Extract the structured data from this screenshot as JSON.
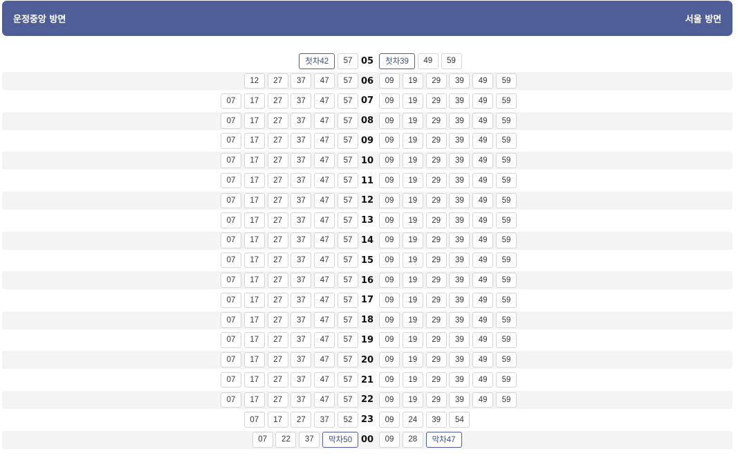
{
  "header": {
    "left_direction": "운정중앙 방면",
    "right_direction": "서울 방면"
  },
  "colors": {
    "accent": "#505e97",
    "row_alt": "#f4f4f4"
  },
  "schedule": [
    {
      "hour": "05",
      "left": [
        "첫차42",
        "57"
      ],
      "right": [
        "첫차39",
        "49",
        "59"
      ]
    },
    {
      "hour": "06",
      "left": [
        "12",
        "27",
        "37",
        "47",
        "57"
      ],
      "right": [
        "09",
        "19",
        "29",
        "39",
        "49",
        "59"
      ]
    },
    {
      "hour": "07",
      "left": [
        "07",
        "17",
        "27",
        "37",
        "47",
        "57"
      ],
      "right": [
        "09",
        "19",
        "29",
        "39",
        "49",
        "59"
      ]
    },
    {
      "hour": "08",
      "left": [
        "07",
        "17",
        "27",
        "37",
        "47",
        "57"
      ],
      "right": [
        "09",
        "19",
        "29",
        "39",
        "49",
        "59"
      ]
    },
    {
      "hour": "09",
      "left": [
        "07",
        "17",
        "27",
        "37",
        "47",
        "57"
      ],
      "right": [
        "09",
        "19",
        "29",
        "39",
        "49",
        "59"
      ]
    },
    {
      "hour": "10",
      "left": [
        "07",
        "17",
        "27",
        "37",
        "47",
        "57"
      ],
      "right": [
        "09",
        "19",
        "29",
        "39",
        "49",
        "59"
      ]
    },
    {
      "hour": "11",
      "left": [
        "07",
        "17",
        "27",
        "37",
        "47",
        "57"
      ],
      "right": [
        "09",
        "19",
        "29",
        "39",
        "49",
        "59"
      ]
    },
    {
      "hour": "12",
      "left": [
        "07",
        "17",
        "27",
        "37",
        "47",
        "57"
      ],
      "right": [
        "09",
        "19",
        "29",
        "39",
        "49",
        "59"
      ]
    },
    {
      "hour": "13",
      "left": [
        "07",
        "17",
        "27",
        "37",
        "47",
        "57"
      ],
      "right": [
        "09",
        "19",
        "29",
        "39",
        "49",
        "59"
      ]
    },
    {
      "hour": "14",
      "left": [
        "07",
        "17",
        "27",
        "37",
        "47",
        "57"
      ],
      "right": [
        "09",
        "19",
        "29",
        "39",
        "49",
        "59"
      ]
    },
    {
      "hour": "15",
      "left": [
        "07",
        "17",
        "27",
        "37",
        "47",
        "57"
      ],
      "right": [
        "09",
        "19",
        "29",
        "39",
        "49",
        "59"
      ]
    },
    {
      "hour": "16",
      "left": [
        "07",
        "17",
        "27",
        "37",
        "47",
        "57"
      ],
      "right": [
        "09",
        "19",
        "29",
        "39",
        "49",
        "59"
      ]
    },
    {
      "hour": "17",
      "left": [
        "07",
        "17",
        "27",
        "37",
        "47",
        "57"
      ],
      "right": [
        "09",
        "19",
        "29",
        "39",
        "49",
        "59"
      ]
    },
    {
      "hour": "18",
      "left": [
        "07",
        "17",
        "27",
        "37",
        "47",
        "57"
      ],
      "right": [
        "09",
        "19",
        "29",
        "39",
        "49",
        "59"
      ]
    },
    {
      "hour": "19",
      "left": [
        "07",
        "17",
        "27",
        "37",
        "47",
        "57"
      ],
      "right": [
        "09",
        "19",
        "29",
        "39",
        "49",
        "59"
      ]
    },
    {
      "hour": "20",
      "left": [
        "07",
        "17",
        "27",
        "37",
        "47",
        "57"
      ],
      "right": [
        "09",
        "19",
        "29",
        "39",
        "49",
        "59"
      ]
    },
    {
      "hour": "21",
      "left": [
        "07",
        "17",
        "27",
        "37",
        "47",
        "57"
      ],
      "right": [
        "09",
        "19",
        "29",
        "39",
        "49",
        "59"
      ]
    },
    {
      "hour": "22",
      "left": [
        "07",
        "17",
        "27",
        "37",
        "47",
        "57"
      ],
      "right": [
        "09",
        "19",
        "29",
        "39",
        "49",
        "59"
      ]
    },
    {
      "hour": "23",
      "left": [
        "07",
        "17",
        "27",
        "37",
        "52"
      ],
      "right": [
        "09",
        "24",
        "39",
        "54"
      ]
    },
    {
      "hour": "00",
      "left": [
        "07",
        "22",
        "37",
        "막차50"
      ],
      "right": [
        "09",
        "28",
        "막차47"
      ]
    }
  ]
}
